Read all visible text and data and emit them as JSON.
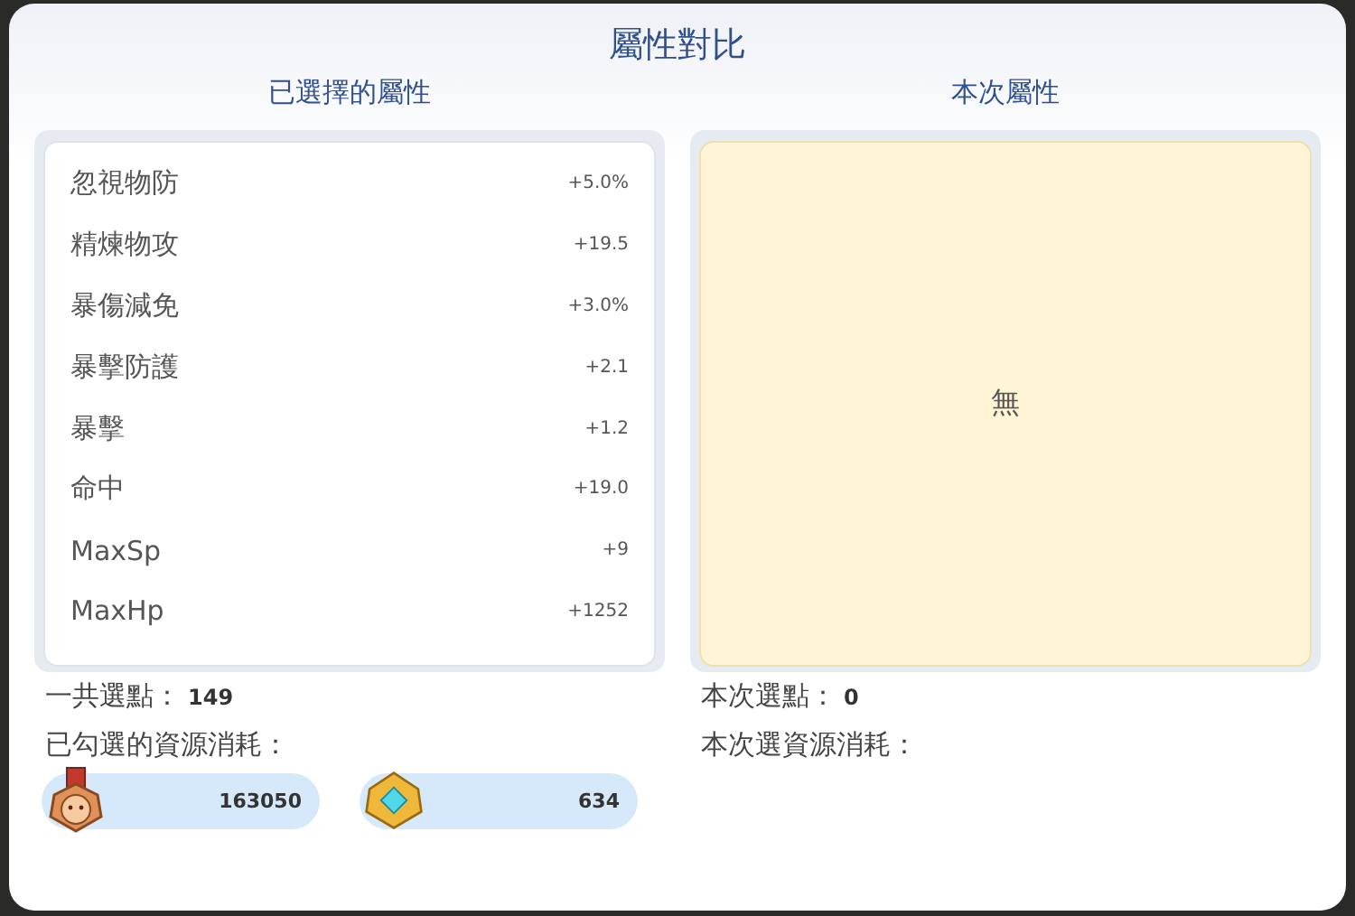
{
  "title": "屬性對比",
  "selected_panel": {
    "heading": "已選擇的屬性",
    "stats": [
      {
        "name": "忽視物防",
        "value": "+5.0%"
      },
      {
        "name": "精煉物攻",
        "value": "+19.5"
      },
      {
        "name": "暴傷減免",
        "value": "+3.0%"
      },
      {
        "name": "暴擊防護",
        "value": "+2.1"
      },
      {
        "name": "暴擊",
        "value": "+1.2"
      },
      {
        "name": "命中",
        "value": "+19.0"
      },
      {
        "name": "MaxSp",
        "value": "+9"
      },
      {
        "name": "MaxHp",
        "value": "+1252"
      }
    ],
    "points_label": "一共選點：",
    "points": "149",
    "cost_label": "已勾選的資源消耗：",
    "resources": [
      {
        "kind": "medal",
        "amount": "163050"
      },
      {
        "kind": "crystal",
        "amount": "634"
      }
    ]
  },
  "current_panel": {
    "heading": "本次屬性",
    "empty_text": "無",
    "points_label": "本次選點：",
    "points": "0",
    "cost_label": "本次選資源消耗："
  }
}
